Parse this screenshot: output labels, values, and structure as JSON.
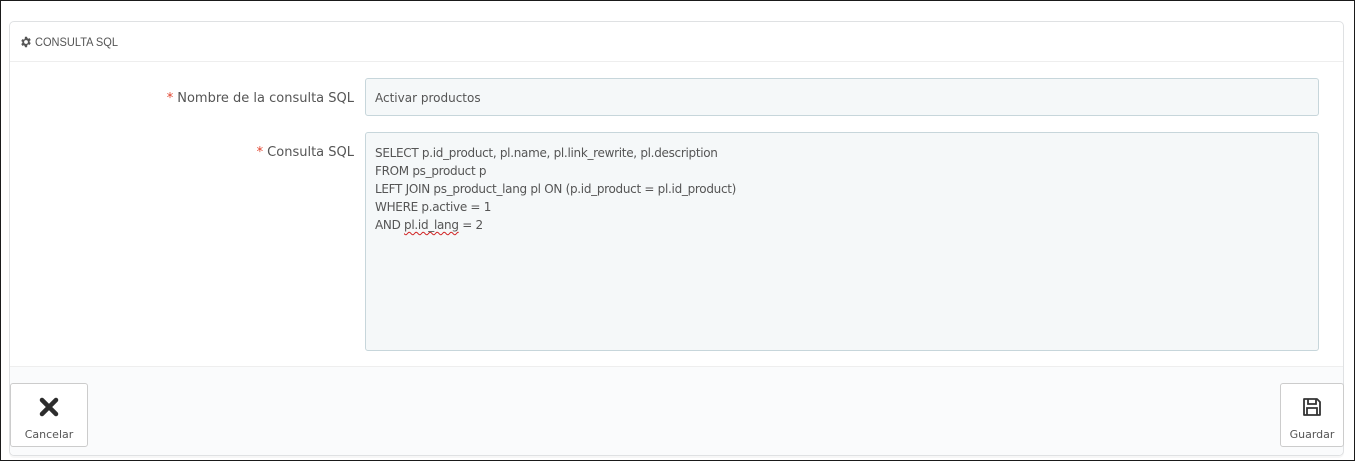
{
  "panel": {
    "title": "CONSULTA SQL",
    "title_icon": "gear-icon"
  },
  "form": {
    "name_field": {
      "required_mark": "*",
      "label": "Nombre de la consulta SQL",
      "value": "Activar productos"
    },
    "sql_field": {
      "required_mark": "*",
      "label": "Consulta SQL",
      "lines": [
        "SELECT p.id_product, pl.name, pl.link_rewrite, pl.description",
        "FROM ps_product p",
        "LEFT JOIN ps_product_lang pl ON (p.id_product = pl.id_product)",
        "WHERE p.active = 1",
        "AND pl.id_lang = 2"
      ]
    }
  },
  "footer": {
    "cancel_label": "Cancelar",
    "cancel_icon": "close-icon",
    "save_label": "Guardar",
    "save_icon": "floppy-disk-icon"
  },
  "colors": {
    "required": "#e0422c",
    "input_bg": "#f5f8f9",
    "input_border": "#c7d6db",
    "text": "#555555"
  }
}
